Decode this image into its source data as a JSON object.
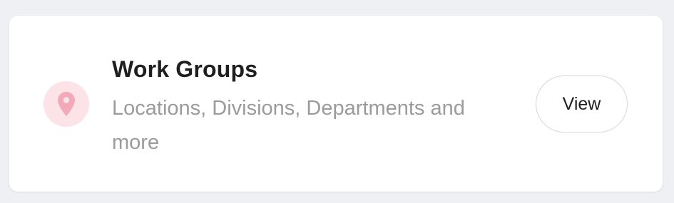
{
  "card": {
    "title": "Work Groups",
    "subtitle": "Locations, Divisions, Departments and more",
    "icon": "location-pin-icon",
    "icon_color": "#f4a9b8",
    "icon_bg": "#fbe3e7",
    "button_label": "View"
  }
}
